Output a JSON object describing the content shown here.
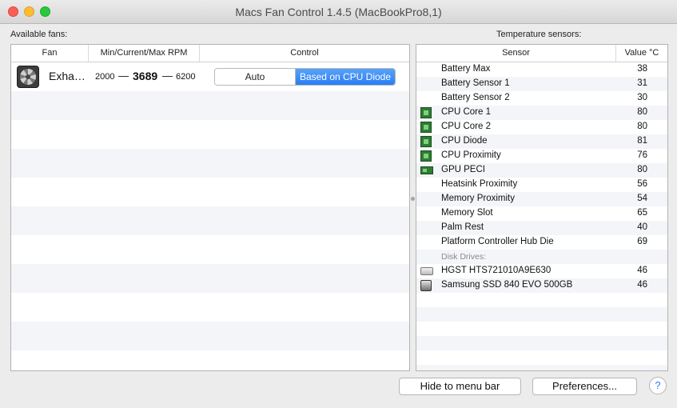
{
  "window": {
    "title": "Macs Fan Control 1.4.5 (MacBookPro8,1)"
  },
  "fans": {
    "label": "Available fans:",
    "columns": {
      "fan": "Fan",
      "rpm": "Min/Current/Max RPM",
      "control": "Control"
    },
    "rows": [
      {
        "name": "Exha…",
        "min_rpm": "2000",
        "current_rpm": "3689",
        "max_rpm": "6200",
        "dash": "—",
        "control_auto": "Auto",
        "control_selected": "Based on CPU Diode"
      }
    ]
  },
  "sensors": {
    "label": "Temperature sensors:",
    "columns": {
      "sensor": "Sensor",
      "value": "Value °C"
    },
    "items": [
      {
        "name": "Battery Max",
        "value": "38",
        "icon": ""
      },
      {
        "name": "Battery Sensor 1",
        "value": "31",
        "icon": ""
      },
      {
        "name": "Battery Sensor 2",
        "value": "30",
        "icon": ""
      },
      {
        "name": "CPU Core 1",
        "value": "80",
        "icon": "cpu-chip-icon"
      },
      {
        "name": "CPU Core 2",
        "value": "80",
        "icon": "cpu-chip-icon"
      },
      {
        "name": "CPU Diode",
        "value": "81",
        "icon": "cpu-chip-icon"
      },
      {
        "name": "CPU Proximity",
        "value": "76",
        "icon": "cpu-chip-icon"
      },
      {
        "name": "GPU PECI",
        "value": "80",
        "icon": "gpu-card-icon"
      },
      {
        "name": "Heatsink Proximity",
        "value": "56",
        "icon": ""
      },
      {
        "name": "Memory Proximity",
        "value": "54",
        "icon": ""
      },
      {
        "name": "Memory Slot",
        "value": "65",
        "icon": ""
      },
      {
        "name": "Palm Rest",
        "value": "40",
        "icon": ""
      },
      {
        "name": "Platform Controller Hub Die",
        "value": "69",
        "icon": ""
      }
    ],
    "disk_header": "Disk Drives:",
    "disks": [
      {
        "name": "HGST HTS721010A9E630",
        "value": "46",
        "icon": "hard-drive-icon"
      },
      {
        "name": "Samsung SSD 840 EVO 500GB",
        "value": "46",
        "icon": "ssd-icon"
      }
    ]
  },
  "buttons": {
    "hide": "Hide to menu bar",
    "preferences": "Preferences...",
    "help": "?"
  }
}
